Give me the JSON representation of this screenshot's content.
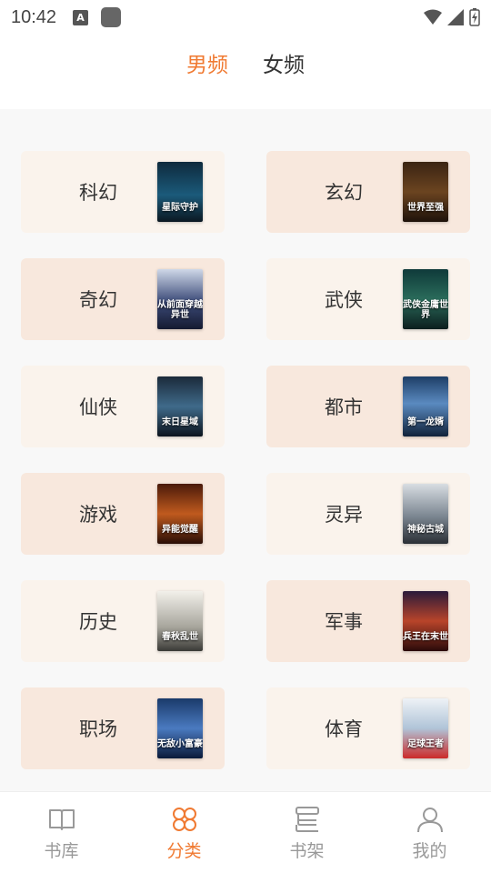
{
  "status": {
    "time": "10:42",
    "a_icon": "A"
  },
  "tabs": [
    {
      "label": "男频",
      "active": true
    },
    {
      "label": "女频",
      "active": false
    }
  ],
  "categories": [
    {
      "label": "科幻",
      "cover_text": "星际守护",
      "bg": "light",
      "cover": "scifi"
    },
    {
      "label": "玄幻",
      "cover_text": "世界至强",
      "bg": "dark",
      "cover": "xuanhuan"
    },
    {
      "label": "奇幻",
      "cover_text": "从前面穿越异世",
      "bg": "dark",
      "cover": "fantasy"
    },
    {
      "label": "武侠",
      "cover_text": "武侠金庸世界",
      "bg": "light",
      "cover": "wuxia"
    },
    {
      "label": "仙侠",
      "cover_text": "末日星域",
      "bg": "light",
      "cover": "xianxia"
    },
    {
      "label": "都市",
      "cover_text": "第一龙婿",
      "bg": "dark",
      "cover": "city"
    },
    {
      "label": "游戏",
      "cover_text": "异能觉醒",
      "bg": "dark",
      "cover": "game"
    },
    {
      "label": "灵异",
      "cover_text": "神秘古城",
      "bg": "light",
      "cover": "supernatural"
    },
    {
      "label": "历史",
      "cover_text": "春秋乱世",
      "bg": "light",
      "cover": "history"
    },
    {
      "label": "军事",
      "cover_text": "兵王在末世",
      "bg": "dark",
      "cover": "military"
    },
    {
      "label": "职场",
      "cover_text": "无敌小富豪",
      "bg": "dark",
      "cover": "career"
    },
    {
      "label": "体育",
      "cover_text": "足球王者",
      "bg": "light",
      "cover": "sports"
    }
  ],
  "nav": [
    {
      "label": "书库",
      "icon": "book-open-icon",
      "active": false
    },
    {
      "label": "分类",
      "icon": "category-grid-icon",
      "active": true
    },
    {
      "label": "书架",
      "icon": "bookshelf-icon",
      "active": false
    },
    {
      "label": "我的",
      "icon": "user-icon",
      "active": false
    }
  ],
  "colors": {
    "accent": "#f07a32",
    "inactive": "#999999",
    "card_light": "#faf3ec",
    "card_dark": "#f8e8dd",
    "background": "#f8f8f8"
  }
}
